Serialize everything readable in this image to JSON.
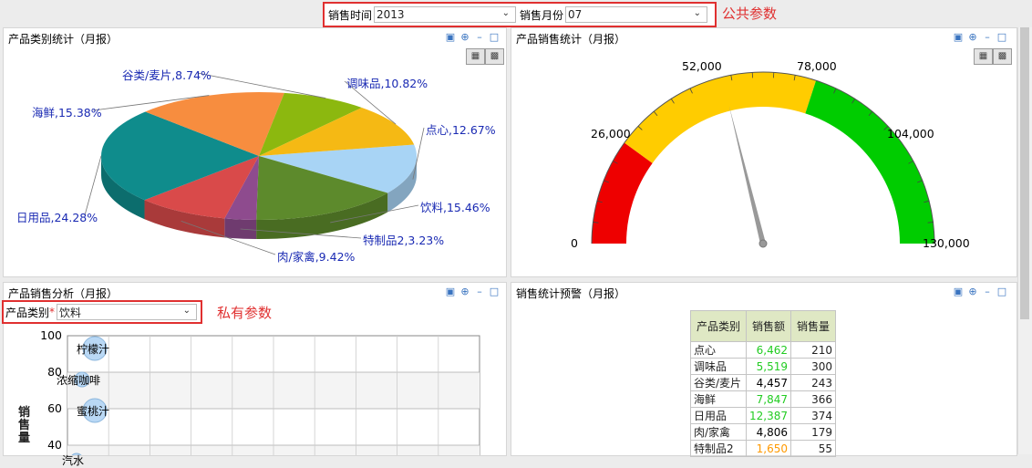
{
  "params": {
    "sales_time_label": "销售时间",
    "sales_time_value": "2013",
    "sales_month_label": "销售月份",
    "sales_month_value": "07",
    "public_note": "公共参数"
  },
  "panels": {
    "category_stats": {
      "title": "产品类别统计（月报）"
    },
    "sales_stats": {
      "title": "产品销售统计（月报）"
    },
    "sales_analysis": {
      "title": "产品销售分析（月报）"
    },
    "sales_warning": {
      "title": "销售统计预警（月报）"
    }
  },
  "private_param": {
    "label": "产品类别",
    "required_mark": "*",
    "value": "饮料",
    "note": "私有参数"
  },
  "chart_data": [
    {
      "type": "pie",
      "slices": [
        {
          "label": "点心,12.67%",
          "name": "点心",
          "value": 12.67,
          "color": "#a8d4f5"
        },
        {
          "label": "饮料,15.46%",
          "name": "饮料",
          "value": 15.46,
          "color": "#5d8a2c"
        },
        {
          "label": "特制品2,3.23%",
          "name": "特制品2",
          "value": 3.23,
          "color": "#8e4b8e"
        },
        {
          "label": "肉/家禽,9.42%",
          "name": "肉/家禽",
          "value": 9.42,
          "color": "#d94a4a"
        },
        {
          "label": "日用品,24.28%",
          "name": "日用品",
          "value": 24.28,
          "color": "#0f8c8c"
        },
        {
          "label": "海鲜,15.38%",
          "name": "海鲜",
          "value": 15.38,
          "color": "#f78d3f"
        },
        {
          "label": "谷类/麦片,8.74%",
          "name": "谷类/麦片",
          "value": 8.74,
          "color": "#8cb80f"
        },
        {
          "label": "调味品,10.82%",
          "name": "调味品",
          "value": 10.82,
          "color": "#f5b914"
        }
      ]
    },
    {
      "type": "gauge",
      "min": 0,
      "max": 130000,
      "ticks": [
        "0",
        "26,000",
        "52,000",
        "78,000",
        "104,000",
        "130,000"
      ],
      "bands": [
        {
          "from": 0,
          "to": 26000,
          "color": "#ee0000"
        },
        {
          "from": 26000,
          "to": 78000,
          "color": "#ffcc00"
        },
        {
          "from": 78000,
          "to": 130000,
          "color": "#00cc00"
        }
      ],
      "value": 55000
    },
    {
      "type": "scatter",
      "ylabel": "销售量",
      "yticks": [
        "100",
        "80",
        "60",
        "40"
      ],
      "ylim": [
        30,
        100
      ],
      "points": [
        {
          "name": "柠檬汁",
          "y": 93
        },
        {
          "name": "浓缩咖啡",
          "y": 76
        },
        {
          "name": "蜜桃汁",
          "y": 59
        },
        {
          "name": "汽水",
          "y": 32
        }
      ]
    },
    {
      "type": "table",
      "columns": [
        "产品类别",
        "销售额",
        "销售量"
      ],
      "rows": [
        {
          "cat": "点心",
          "amount": "6,462",
          "qty": "210",
          "color": "#22cc22"
        },
        {
          "cat": "调味品",
          "amount": "5,519",
          "qty": "300",
          "color": "#22cc22"
        },
        {
          "cat": "谷类/麦片",
          "amount": "4,457",
          "qty": "243",
          "color": "#000000"
        },
        {
          "cat": "海鲜",
          "amount": "7,847",
          "qty": "366",
          "color": "#22cc22"
        },
        {
          "cat": "日用品",
          "amount": "12,387",
          "qty": "374",
          "color": "#22cc22"
        },
        {
          "cat": "肉/家禽",
          "amount": "4,806",
          "qty": "179",
          "color": "#000000"
        },
        {
          "cat": "特制品2",
          "amount": "1,650",
          "qty": "55",
          "color": "#ff9900"
        }
      ]
    }
  ]
}
